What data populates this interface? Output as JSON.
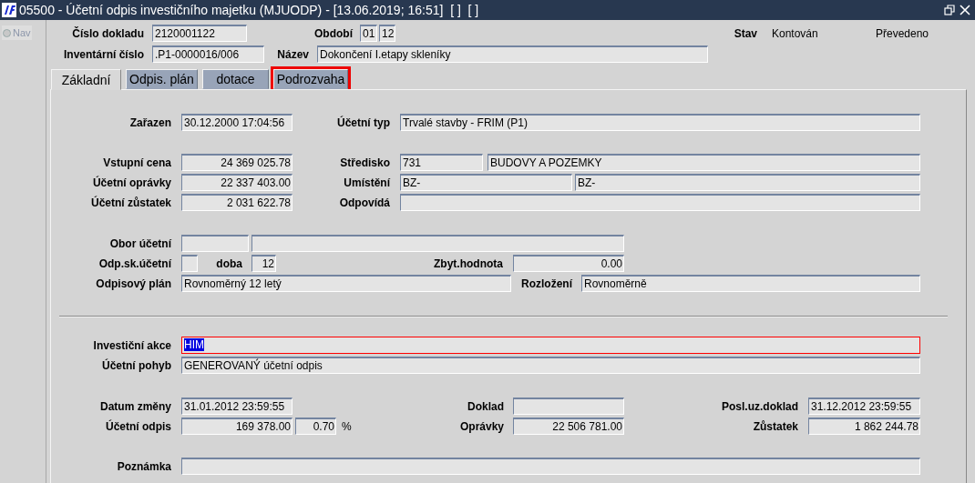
{
  "window": {
    "title": "05500 - Účetní odpis investičního majetku (MJUODP) - [13.06.2019; 16:51]  [ ]  [ ]"
  },
  "nav": {
    "label": "Nav",
    "selected": false
  },
  "header": {
    "rows": [
      {
        "items": [
          {
            "kind": "label",
            "text": "Číslo dokladu"
          },
          {
            "kind": "field",
            "value": "2120001122",
            "focused": false
          },
          {
            "kind": "label",
            "text": "Období"
          },
          {
            "kind": "field",
            "value": "01",
            "focused": false
          },
          {
            "kind": "field",
            "value": "12",
            "focused": false
          },
          {
            "kind": "label",
            "text": "Stav"
          },
          {
            "kind": "text",
            "text": "Kontován"
          },
          {
            "kind": "text",
            "text": "Převedeno"
          }
        ]
      },
      {
        "items": [
          {
            "kind": "label",
            "text": "Inventární číslo"
          },
          {
            "kind": "field",
            "value": ".P1-0000016/006",
            "focused": false
          },
          {
            "kind": "label",
            "text": "Název"
          },
          {
            "kind": "field",
            "value": "Dokončení I.etapy skleníky",
            "focused": false
          }
        ]
      }
    ]
  },
  "tabs": [
    {
      "label": "Základní",
      "selected": true,
      "highlighted": false
    },
    {
      "label": "Odpis. plán",
      "selected": false,
      "highlighted": false
    },
    {
      "label": "dotace",
      "selected": false,
      "highlighted": false
    },
    {
      "label": "Podrozvaha",
      "selected": false,
      "highlighted": true
    }
  ],
  "panel": {
    "sections": [
      {
        "rows": [
          {
            "items": [
              {
                "kind": "label",
                "text": "Zařazen"
              },
              {
                "kind": "field",
                "value": "30.12.2000 17:04:56",
                "focused": false
              },
              {
                "kind": "label",
                "text": "Účetní typ"
              },
              {
                "kind": "field",
                "value": "Trvalé stavby - FRIM (P1)",
                "focused": false
              }
            ]
          },
          {
            "items": [
              {
                "kind": "label",
                "text": "Vstupní cena"
              },
              {
                "kind": "field",
                "value": "24 369 025.78",
                "focused": false
              },
              {
                "kind": "label",
                "text": "Středisko"
              },
              {
                "kind": "field",
                "value": "731",
                "focused": false
              },
              {
                "kind": "field",
                "value": "BUDOVY A POZEMKY",
                "focused": false
              }
            ]
          },
          {
            "items": [
              {
                "kind": "label",
                "text": "Účetní oprávky"
              },
              {
                "kind": "field",
                "value": "22 337 403.00",
                "focused": false
              },
              {
                "kind": "label",
                "text": "Umístění"
              },
              {
                "kind": "field",
                "value": "BZ-",
                "focused": false
              },
              {
                "kind": "field",
                "value": "BZ-",
                "focused": false
              }
            ]
          },
          {
            "items": [
              {
                "kind": "label",
                "text": "Účetní zůstatek"
              },
              {
                "kind": "field",
                "value": "2 031 622.78",
                "focused": false
              },
              {
                "kind": "label",
                "text": "Odpovídá"
              },
              {
                "kind": "field",
                "focused": false
              }
            ]
          },
          {
            "items": [
              {
                "kind": "label",
                "text": "Obor účetní"
              },
              {
                "kind": "field",
                "focused": false
              },
              {
                "kind": "field",
                "focused": false
              }
            ]
          },
          {
            "items": [
              {
                "kind": "label",
                "text": "Odp.sk.účetní"
              },
              {
                "kind": "field",
                "focused": false
              },
              {
                "kind": "label",
                "text": "doba"
              },
              {
                "kind": "field",
                "value": "12",
                "focused": false
              },
              {
                "kind": "label",
                "text": "Zbyt.hodnota"
              },
              {
                "kind": "field",
                "value": "0.00",
                "focused": false
              }
            ]
          },
          {
            "items": [
              {
                "kind": "label",
                "text": "Odpisový plán"
              },
              {
                "kind": "field",
                "value": "Rovnoměrný 12 letý",
                "focused": false
              },
              {
                "kind": "label",
                "text": "Rozložení"
              },
              {
                "kind": "field",
                "value": "Rovnoměrně",
                "focused": false
              }
            ]
          }
        ]
      },
      {
        "rows": [
          {
            "items": [
              {
                "kind": "label",
                "text": "Investiční akce"
              },
              {
                "kind": "field",
                "value": "HIM",
                "focused": true
              }
            ]
          },
          {
            "items": [
              {
                "kind": "label",
                "text": "Účetní pohyb"
              },
              {
                "kind": "field",
                "value": "GENEROVANÝ účetní odpis",
                "focused": false
              }
            ]
          },
          {
            "items": [
              {
                "kind": "label",
                "text": "Datum změny"
              },
              {
                "kind": "field",
                "value": "31.01.2012 23:59:55",
                "focused": false
              },
              {
                "kind": "label",
                "text": "Doklad"
              },
              {
                "kind": "field",
                "focused": false
              },
              {
                "kind": "label",
                "text": "Posl.uz.doklad"
              },
              {
                "kind": "field",
                "value": "31.12.2012 23:59:55",
                "focused": false
              }
            ]
          },
          {
            "items": [
              {
                "kind": "label",
                "text": "Účetní odpis"
              },
              {
                "kind": "field",
                "value": "169 378.00",
                "focused": false
              },
              {
                "kind": "field",
                "value": "0.70",
                "focused": false
              },
              {
                "kind": "text",
                "text": "%"
              },
              {
                "kind": "label",
                "text": "Oprávky"
              },
              {
                "kind": "field",
                "value": "22 506 781.00",
                "focused": false
              },
              {
                "kind": "label",
                "text": "Zůstatek"
              },
              {
                "kind": "field",
                "value": "1 862 244.78",
                "focused": false
              }
            ]
          },
          {
            "items": [
              {
                "kind": "label",
                "text": "Poznámka"
              },
              {
                "kind": "field",
                "focused": false
              }
            ]
          }
        ]
      }
    ]
  }
}
